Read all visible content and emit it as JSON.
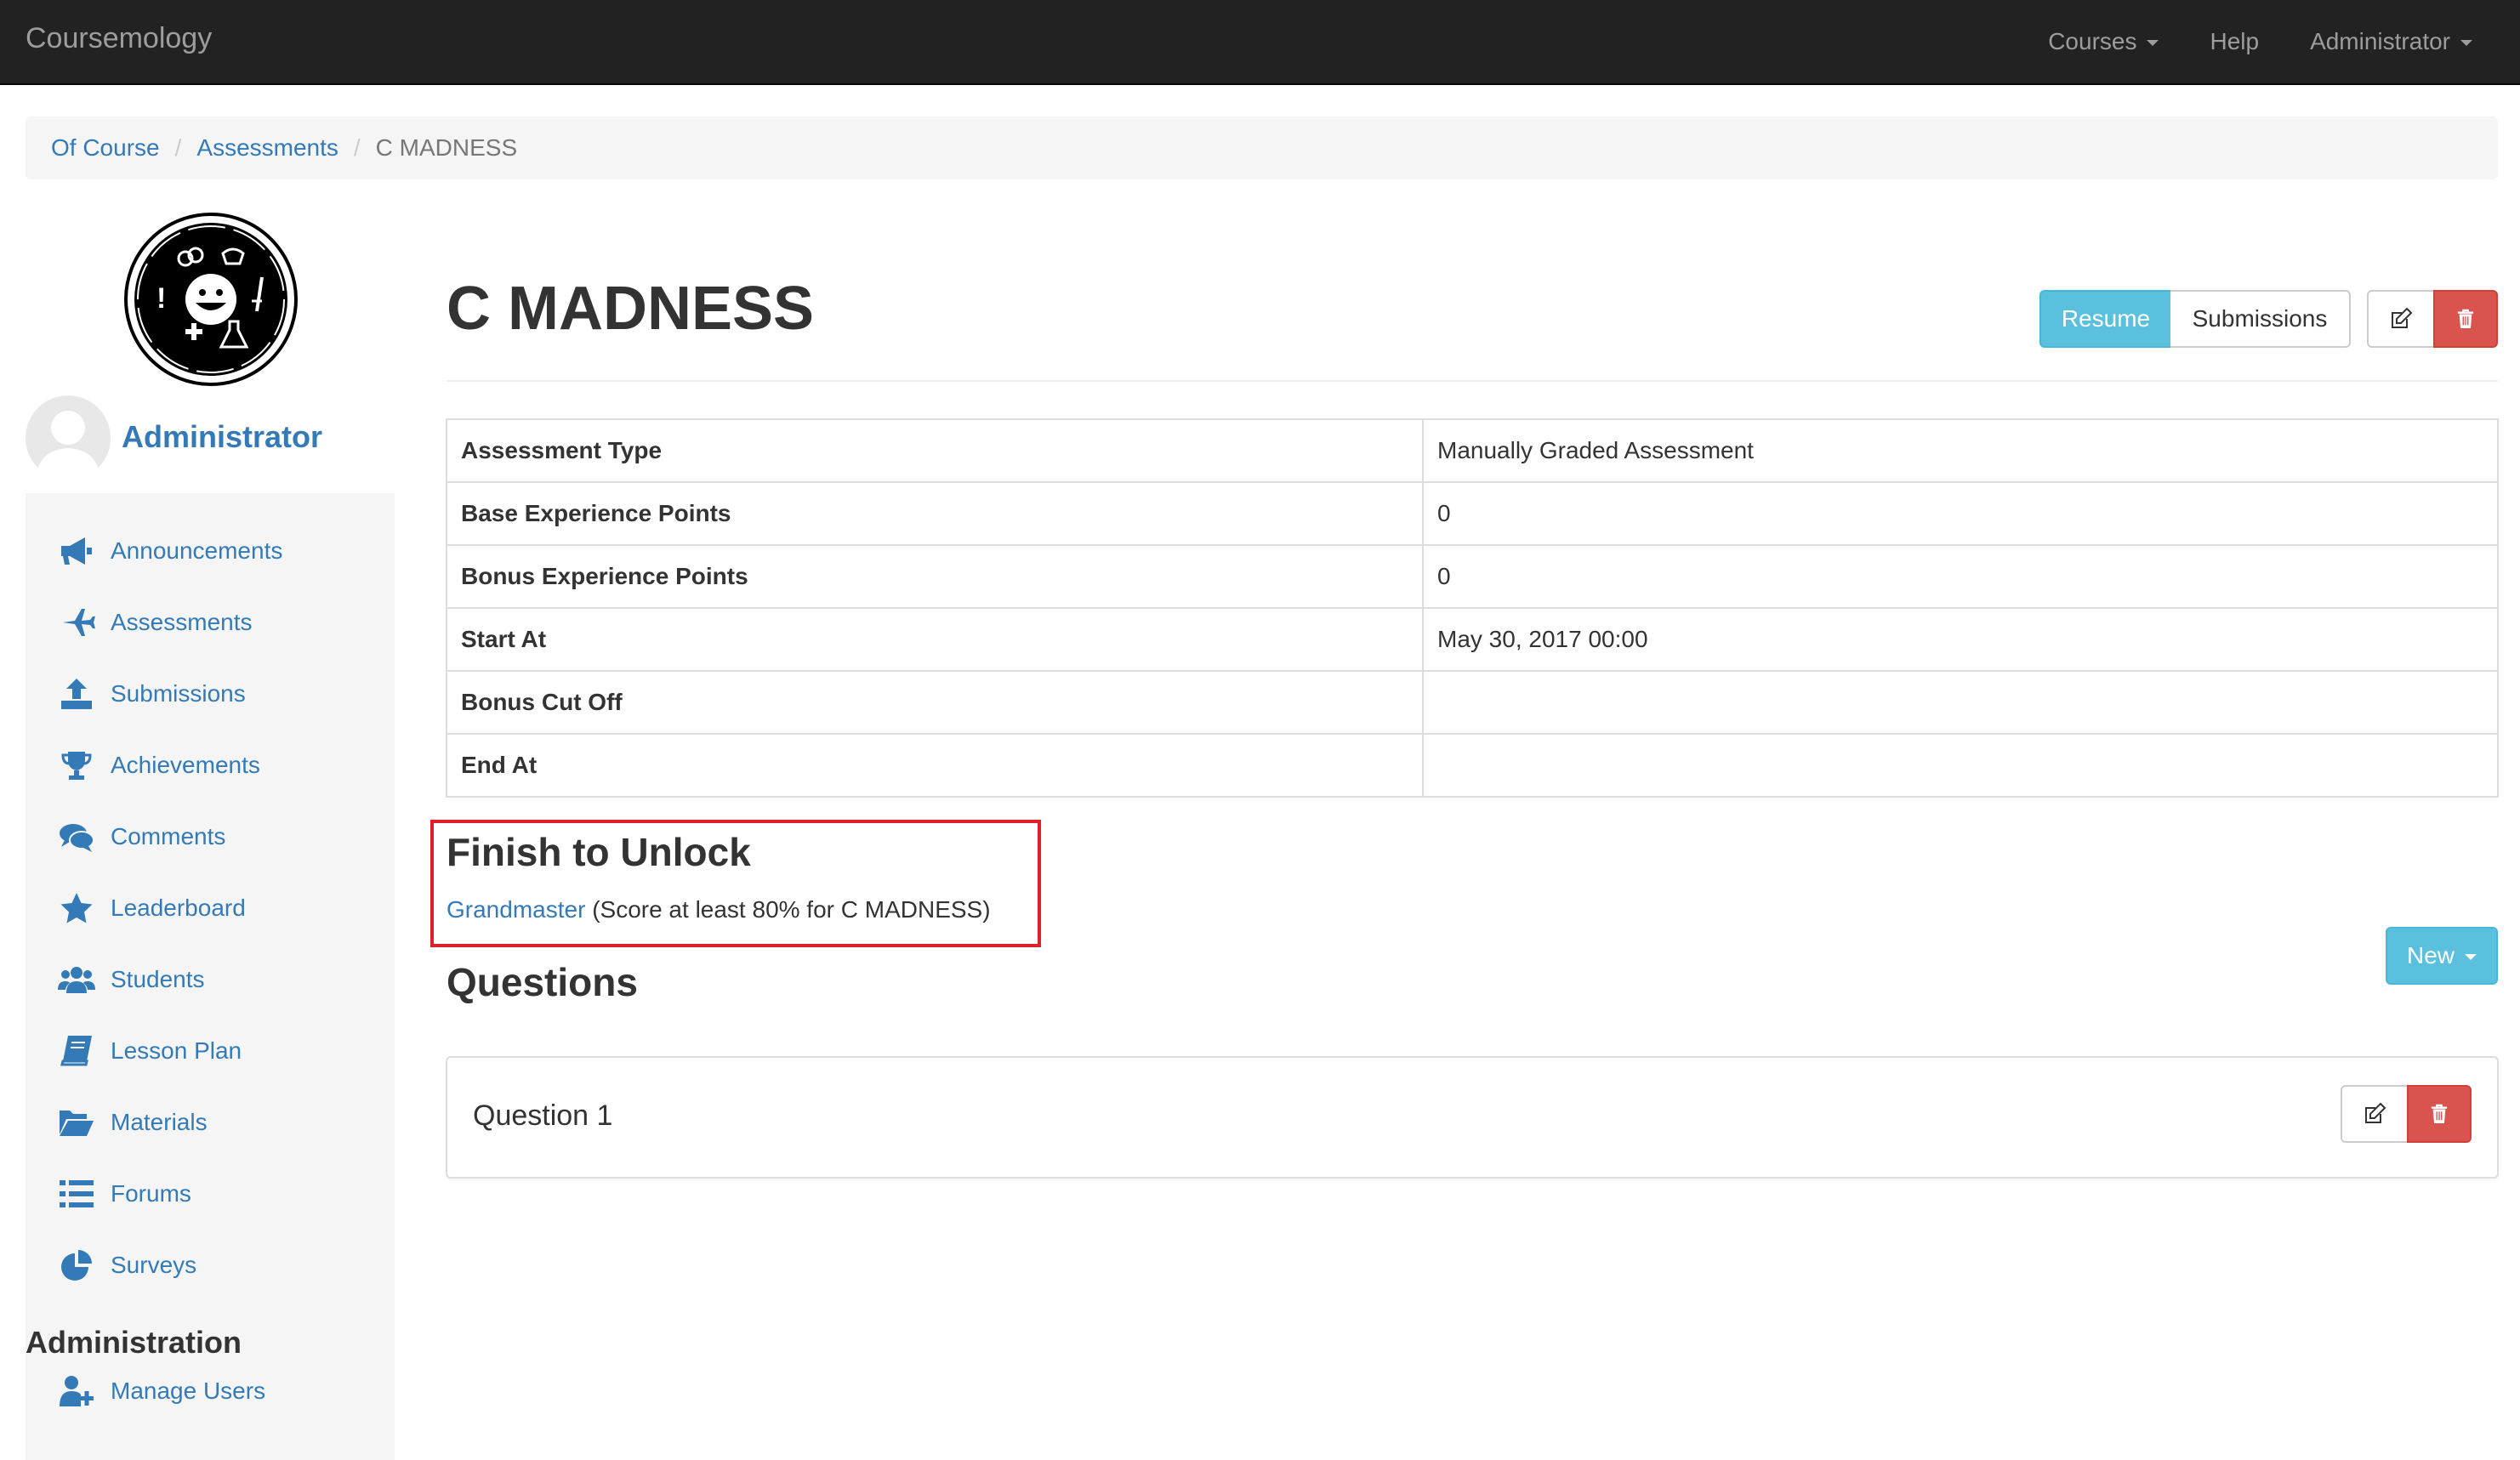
{
  "navbar": {
    "brand": "Coursemology",
    "items": [
      {
        "label": "Courses",
        "dropdown": true
      },
      {
        "label": "Help",
        "dropdown": false
      },
      {
        "label": "Administrator",
        "dropdown": true
      }
    ]
  },
  "breadcrumb": [
    "Of Course",
    "Assessments",
    "C MADNESS"
  ],
  "sidebar": {
    "user_name": "Administrator",
    "items": [
      {
        "label": "Announcements",
        "icon": "bullhorn-icon"
      },
      {
        "label": "Assessments",
        "icon": "plane-icon"
      },
      {
        "label": "Submissions",
        "icon": "upload-icon"
      },
      {
        "label": "Achievements",
        "icon": "trophy-icon"
      },
      {
        "label": "Comments",
        "icon": "comments-icon"
      },
      {
        "label": "Leaderboard",
        "icon": "star-icon"
      },
      {
        "label": "Students",
        "icon": "users-icon"
      },
      {
        "label": "Lesson Plan",
        "icon": "book-icon"
      },
      {
        "label": "Materials",
        "icon": "folder-open-icon"
      },
      {
        "label": "Forums",
        "icon": "list-icon"
      },
      {
        "label": "Surveys",
        "icon": "pie-chart-icon"
      }
    ],
    "admin_heading": "Administration",
    "admin_items": [
      {
        "label": "Manage Users",
        "icon": "user-plus-icon"
      }
    ]
  },
  "page": {
    "title": "C MADNESS",
    "resume_label": "Resume",
    "submissions_label": "Submissions",
    "edit_icon": "edit-icon",
    "delete_icon": "trash-icon"
  },
  "details": [
    {
      "key": "Assessment Type",
      "value": "Manually Graded Assessment"
    },
    {
      "key": "Base Experience Points",
      "value": "0"
    },
    {
      "key": "Bonus Experience Points",
      "value": "0"
    },
    {
      "key": "Start At",
      "value": "May 30, 2017 00:00"
    },
    {
      "key": "Bonus Cut Off",
      "value": ""
    },
    {
      "key": "End At",
      "value": ""
    }
  ],
  "unlock": {
    "title": "Finish to Unlock",
    "link": "Grandmaster",
    "description": "(Score at least 80% for C MADNESS)"
  },
  "questions": {
    "title": "Questions",
    "new_label": "New",
    "items": [
      {
        "title": "Question 1"
      }
    ]
  },
  "colors": {
    "navbar_bg": "#222222",
    "link": "#337ab7",
    "info": "#5bc0de",
    "danger": "#d9534f",
    "highlight_box": "#e0202a"
  }
}
